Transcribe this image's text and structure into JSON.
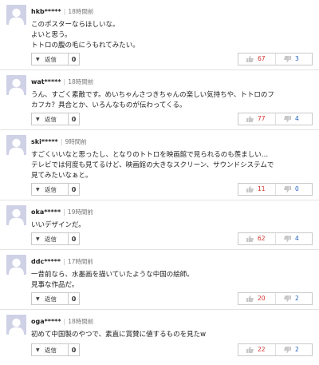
{
  "reply_label": "返信",
  "comments": [
    {
      "user": "hkb*****",
      "time": "18時間前",
      "lines": [
        "このポスターならほしいな。",
        "よいと思う。",
        "トトロの腹の毛にうもれてみたい。"
      ],
      "replies": "0",
      "likes": "67",
      "dislikes": "3"
    },
    {
      "user": "wat*****",
      "time": "18時間前",
      "lines": [
        "うん、すごく素敵です。めいちゃんさつきちゃんの楽しい気持ちや、トトロのフ",
        "カフカ？具合とか、いろんなものが伝わってくる。"
      ],
      "replies": "0",
      "likes": "77",
      "dislikes": "4"
    },
    {
      "user": "ski*****",
      "time": "9時間前",
      "lines": [
        "すごくいいなと思ったし、となりのトトロを映画館で見られるのも羨ましい…",
        "テレビでは何度も見てるけど、映画館の大きなスクリーン、サウンドシステムで",
        "見てみたいなぁと。"
      ],
      "replies": "0",
      "likes": "11",
      "dislikes": "0"
    },
    {
      "user": "oka*****",
      "time": "19時間前",
      "lines": [
        "いいデザインだ。"
      ],
      "replies": "0",
      "likes": "62",
      "dislikes": "4"
    },
    {
      "user": "ddc*****",
      "time": "17時間前",
      "lines": [
        "一昔前なら、水墨画を描いていたような中国の絵師。",
        "見事な作品だ。"
      ],
      "replies": "0",
      "likes": "20",
      "dislikes": "2"
    },
    {
      "user": "oga*****",
      "time": "18時間前",
      "lines": [
        "初めて中国製のやつで、素直に賞賛に値するものを見たw"
      ],
      "replies": "0",
      "likes": "22",
      "dislikes": "2"
    }
  ]
}
